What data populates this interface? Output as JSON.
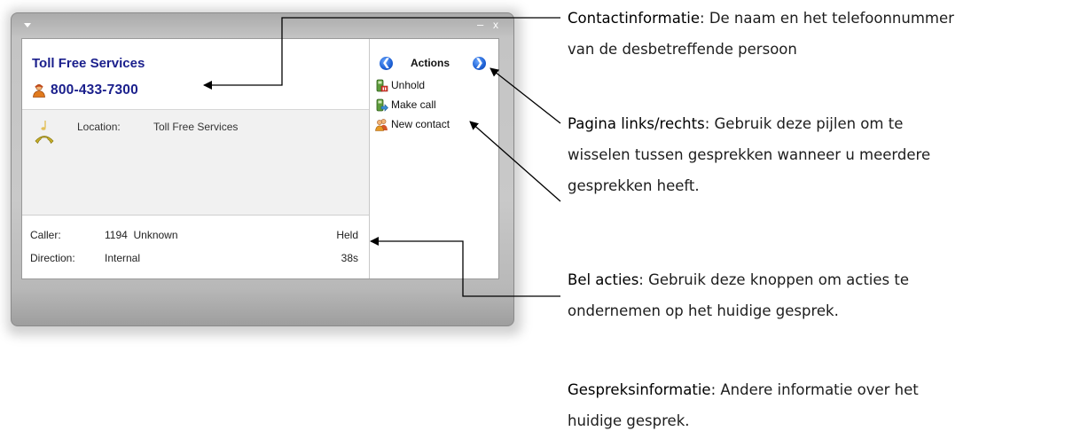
{
  "window": {
    "min_glyph": "–",
    "close_glyph": "x"
  },
  "contact": {
    "name": "Toll Free Services",
    "phone": "800-433-7300"
  },
  "location": {
    "label": "Location:",
    "value": "Toll Free Services"
  },
  "call_info": {
    "caller_label": "Caller:",
    "caller_value": "1194  Unknown",
    "caller_status": "Held",
    "direction_label": "Direction:",
    "direction_value": "Internal",
    "duration": "38s"
  },
  "actions": {
    "title": "Actions",
    "items": [
      {
        "label": "Unhold",
        "icon": "unhold-phone-icon"
      },
      {
        "label": "Make call",
        "icon": "make-call-icon"
      },
      {
        "label": "New contact",
        "icon": "new-contact-icon"
      }
    ]
  },
  "annotations": {
    "contact": {
      "key": "Contactinformatie",
      "text_1": ": De naam en het telefoonnummer",
      "text_2": "van de desbetreffende persoon"
    },
    "paging": {
      "key": "Pagina links/rechts",
      "text_1": ": Gebruik deze pijlen om te",
      "text_2": "wisselen tussen gesprekken wanneer u meerdere",
      "text_3": "gesprekken heeft."
    },
    "actions": {
      "key": "Bel acties",
      "text_1": ": Gebruik deze knoppen om acties te",
      "text_2": "ondernemen op het huidige gesprek."
    },
    "callinfo": {
      "key": "Gespreksinformatie",
      "text_1": ": Andere informatie over het",
      "text_2": "huidige gesprek."
    }
  },
  "colors": {
    "contact_text": "#1a1f8c",
    "arrow_blue": "#1c5fd3"
  }
}
